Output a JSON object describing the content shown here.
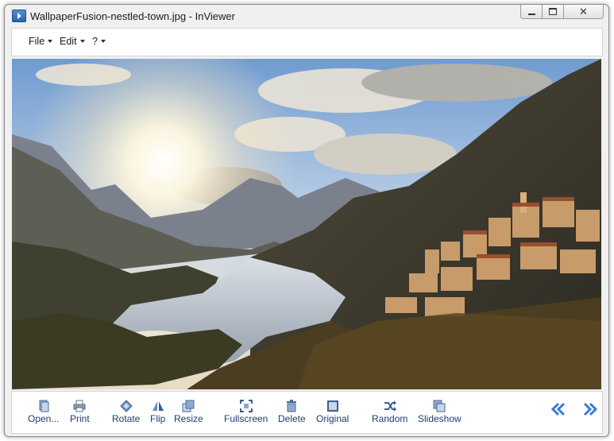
{
  "window": {
    "title": "WallpaperFusion-nestled-town.jpg - InViewer"
  },
  "window_controls": {
    "minimize": "minimize",
    "maximize": "maximize",
    "close": "close"
  },
  "menu": {
    "items": [
      {
        "label": "File"
      },
      {
        "label": "Edit"
      },
      {
        "label": "?"
      }
    ]
  },
  "image": {
    "alt": "Mountain lake village at sunset",
    "accent_sky": "#7fa6d6",
    "accent_sun": "#fff6d8"
  },
  "toolbar": {
    "buttons": [
      {
        "label": "Open...",
        "icon": "open-file-icon"
      },
      {
        "label": "Print",
        "icon": "printer-icon"
      },
      {
        "label": "Rotate",
        "icon": "rotate-icon"
      },
      {
        "label": "Flip",
        "icon": "flip-icon"
      },
      {
        "label": "Resize",
        "icon": "resize-icon"
      },
      {
        "label": "Fullscreen",
        "icon": "fullscreen-icon"
      },
      {
        "label": "Delete",
        "icon": "trash-icon"
      },
      {
        "label": "Original",
        "icon": "original-size-icon"
      },
      {
        "label": "Random",
        "icon": "shuffle-icon"
      },
      {
        "label": "Slideshow",
        "icon": "slideshow-icon"
      }
    ],
    "prev_icon": "double-chevron-left-icon",
    "next_icon": "double-chevron-right-icon",
    "accent_color": "#3a7bd5"
  }
}
